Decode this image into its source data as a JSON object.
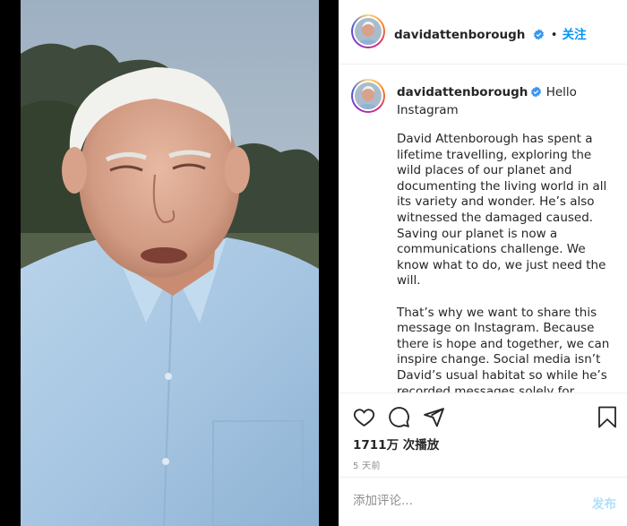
{
  "post": {
    "username": "davidattenborough",
    "follow_label": "关注",
    "caption_title": "Hello Instagram",
    "caption_paragraphs": [
      "David Attenborough has spent a lifetime travelling, exploring the wild places of our planet and documenting the living world in all its variety and wonder. He’s also witnessed the damaged caused. Saving our planet is now a communications challenge. We know what to do, we just need the will.",
      "That’s why we want to share this message on Instagram. Because there is hope and together, we can inspire change. Social media isn’t David’s usual habitat so while he’s recorded messages solely for Instagram, like these in this post, we’re helping to"
    ],
    "views": "1711万 次播放",
    "time_ago": "5 天前"
  },
  "comment_box": {
    "placeholder": "添加评论...",
    "post_label": "发布"
  },
  "icons": [
    "verified-badge-icon",
    "heart-icon",
    "comment-icon",
    "share-icon",
    "bookmark-icon"
  ],
  "colors": {
    "link_blue": "#0095f6",
    "verified_blue": "#3897f0",
    "muted_gray": "#8e8e8e",
    "post_disabled": "#b2dffc"
  }
}
